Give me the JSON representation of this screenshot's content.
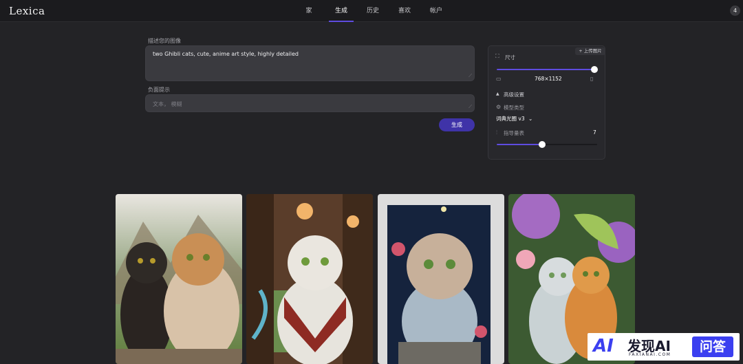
{
  "app": {
    "logo": "Lexica",
    "avatar_count": "4"
  },
  "nav": {
    "items": [
      {
        "label": "家",
        "active": false
      },
      {
        "label": "生成",
        "active": true
      },
      {
        "label": "历史",
        "active": false
      },
      {
        "label": "喜欢",
        "active": false
      },
      {
        "label": "帐户",
        "active": false
      }
    ]
  },
  "form": {
    "prompt_label": "描述您的图像",
    "prompt_value": "two Ghibli cats, cute, anime art style, highly detailed",
    "negative_label": "负面提示",
    "negative_placeholder": "文本， 模糊",
    "generate_label": "生成"
  },
  "settings": {
    "upload_label": "+ 上传图片",
    "size_label": "尺寸",
    "size_slider_level": 1.0,
    "size_value": "768×1152",
    "advanced_label": "高级设置",
    "model_type_label": "模型类型",
    "model_value": "词典光圈 v3",
    "guidance_label": "指导量表",
    "guidance_value": "7",
    "guidance_slider_level": 0.45
  },
  "gallery": {
    "images": [
      {
        "alt": "cats-1"
      },
      {
        "alt": "cats-2"
      },
      {
        "alt": "cats-3"
      },
      {
        "alt": "cats-4"
      }
    ]
  },
  "watermark": {
    "logo": "AI",
    "name": "发现AI",
    "sub": "FAXIANAI.COM",
    "badge": "问答"
  }
}
